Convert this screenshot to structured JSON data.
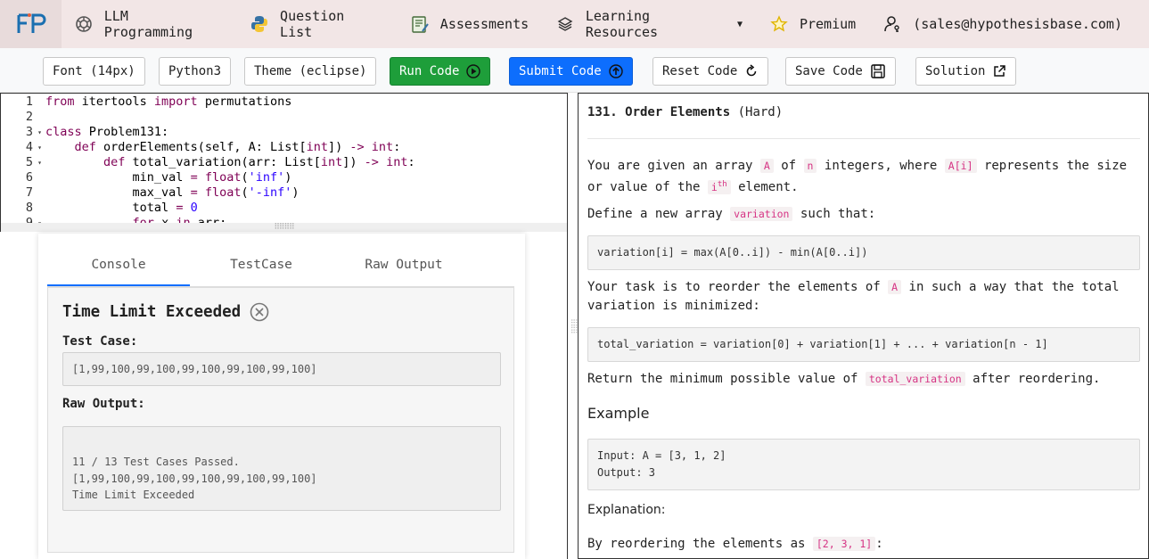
{
  "nav": {
    "items": [
      {
        "label": "LLM Programming",
        "icon": "openai-icon"
      },
      {
        "label": "Question List",
        "icon": "python-icon"
      },
      {
        "label": "Assessments",
        "icon": "assessment-icon"
      },
      {
        "label": "Learning Resources",
        "icon": "layers-icon"
      },
      {
        "label": "Premium",
        "icon": "star-icon"
      },
      {
        "label": "(sales@hypothesisbase.com)",
        "icon": "user-key-icon"
      }
    ]
  },
  "toolbar": {
    "font": "Font (14px)",
    "language": "Python3",
    "theme": "Theme (eclipse)",
    "run": "Run Code",
    "submit": "Submit Code",
    "reset": "Reset Code",
    "save": "Save Code",
    "solution": "Solution"
  },
  "editor": {
    "line_numbers": [
      "1",
      "2",
      "3",
      "4",
      "5",
      "6",
      "7",
      "8",
      "9"
    ]
  },
  "console": {
    "tabs": [
      "Console",
      "TestCase",
      "Raw Output"
    ],
    "status": "Time Limit Exceeded",
    "test_case_label": "Test Case:",
    "test_case_value": "[1,99,100,99,100,99,100,99,100,99,100]",
    "raw_output_label": "Raw Output:",
    "raw_output_lines": [
      "11 / 13 Test Cases Passed.",
      "[1,99,100,99,100,99,100,99,100,99,100]",
      "Time Limit Exceeded"
    ]
  },
  "problem": {
    "number_title": "131. Order Elements",
    "difficulty": "(Hard)",
    "p1_a": "You are given an array",
    "p1_A": "A",
    "p1_b": "of",
    "p1_n": "n",
    "p1_c": "integers, where",
    "p1_Ai": "A[i]",
    "p1_d": "represents the size or value of the",
    "p1_ith": "i",
    "p1_th": "th",
    "p1_e": "element.",
    "p2_a": "Define a new array",
    "p2_var": "variation",
    "p2_b": "such that:",
    "formula1": "variation[i] = max(A[0..i]) - min(A[0..i])",
    "p3_a": "Your task is to reorder the elements of",
    "p3_A": "A",
    "p3_b": "in such a way that the total variation is minimized:",
    "formula2": "total_variation = variation[0] + variation[1] + ... + variation[n - 1]",
    "p4_a": "Return the minimum possible value of",
    "p4_tv": "total_variation",
    "p4_b": "after reordering.",
    "example_heading": "Example",
    "example_input": "Input: A = [3, 1, 2]",
    "example_output": "Output: 3",
    "explanation_label": "Explanation:",
    "p5_a": "By reordering the elements as",
    "p5_arr": "[2, 3, 1]",
    "p5_b": ":"
  }
}
